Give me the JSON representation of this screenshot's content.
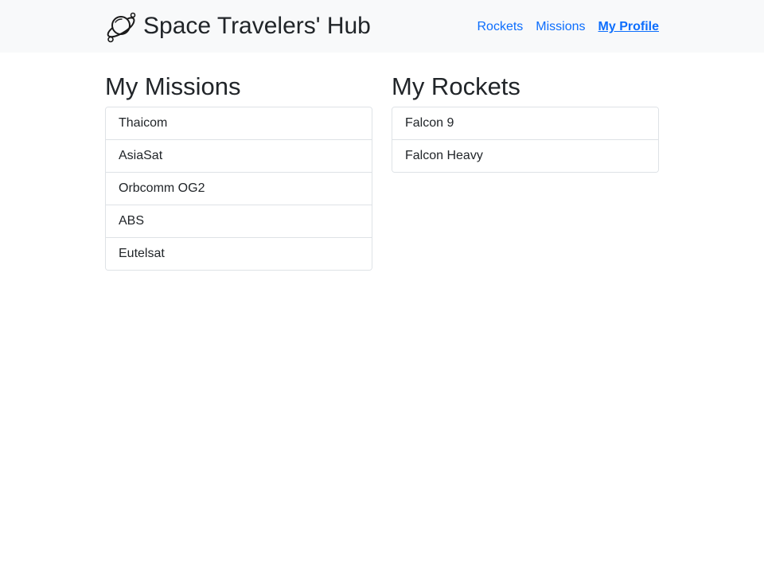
{
  "brand": {
    "title": "Space Travelers' Hub",
    "logo_icon": "planet-icon"
  },
  "nav": {
    "items": [
      {
        "label": "Rockets",
        "active": false
      },
      {
        "label": "Missions",
        "active": false
      },
      {
        "label": "My Profile",
        "active": true
      }
    ]
  },
  "missions": {
    "heading": "My Missions",
    "items": [
      "Thaicom",
      "AsiaSat",
      "Orbcomm OG2",
      "ABS",
      "Eutelsat"
    ]
  },
  "rockets": {
    "heading": "My Rockets",
    "items": [
      "Falcon 9",
      "Falcon Heavy"
    ]
  },
  "colors": {
    "navbar_bg": "#f8f9fa",
    "link": "#0d6efd",
    "border": "#dee2e6",
    "text": "#212529"
  }
}
